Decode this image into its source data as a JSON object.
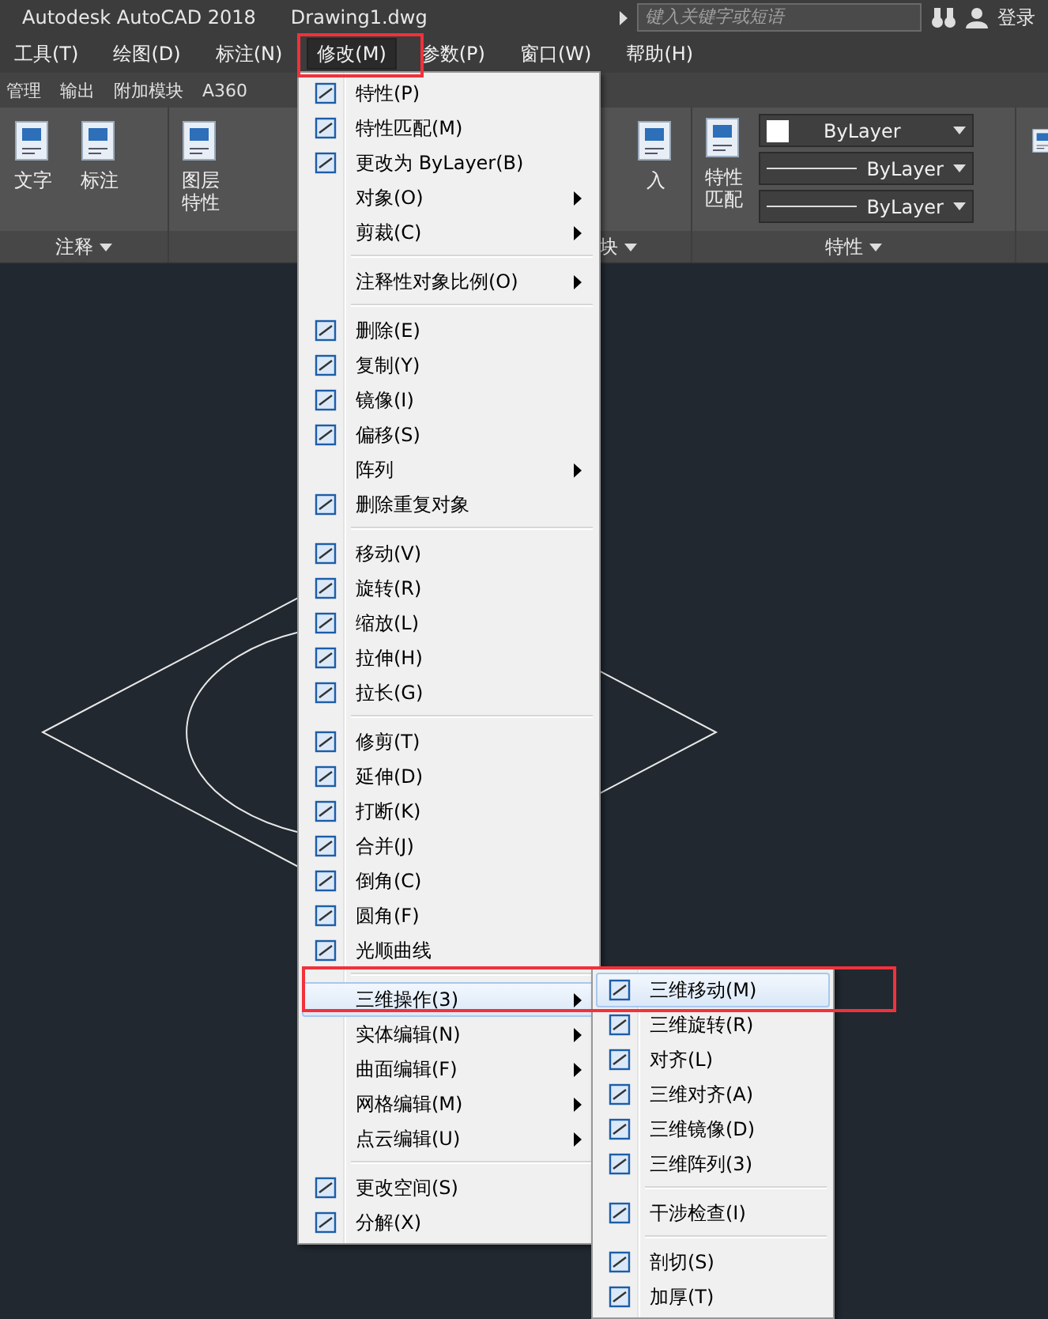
{
  "title_bar": {
    "app": "Autodesk AutoCAD 2018",
    "file": "Drawing1.dwg",
    "search": {
      "placeholder": "键入关键字或短语"
    },
    "sign_in": "登录"
  },
  "menu_bar": [
    {
      "label": "工具(T)",
      "selected": false
    },
    {
      "label": "绘图(D)",
      "selected": false
    },
    {
      "label": "标注(N)",
      "selected": false
    },
    {
      "label": "修改(M)",
      "selected": true
    },
    {
      "label": "参数(P)",
      "selected": false
    },
    {
      "label": "窗口(W)",
      "selected": false
    },
    {
      "label": "帮助(H)",
      "selected": false
    }
  ],
  "ribbon_tabs": [
    "管理",
    "输出",
    "附加模块",
    "A360"
  ],
  "ribbon": {
    "annotate": {
      "title": "注释",
      "buttons": [
        "文字",
        "标注"
      ]
    },
    "layers": {
      "buttons": [
        "图层特性",
        "入"
      ]
    },
    "block": {
      "title": "块"
    },
    "properties": {
      "title": "特性",
      "button": "特性匹配",
      "dropdowns": [
        {
          "kind": "color",
          "value": "ByLayer"
        },
        {
          "kind": "line",
          "value": "ByLayer"
        },
        {
          "kind": "line",
          "value": "ByLayer"
        }
      ]
    },
    "group": {
      "kind": "button"
    }
  },
  "modify_menu": [
    {
      "kind": "item",
      "label": "特性(P)",
      "icon": true,
      "submenu": false,
      "selected": false
    },
    {
      "kind": "item",
      "label": "特性匹配(M)",
      "icon": true,
      "submenu": false,
      "selected": false
    },
    {
      "kind": "item",
      "label": "更改为 ByLayer(B)",
      "icon": true,
      "submenu": false,
      "selected": false
    },
    {
      "kind": "item",
      "label": "对象(O)",
      "icon": false,
      "submenu": true,
      "selected": false
    },
    {
      "kind": "item",
      "label": "剪裁(C)",
      "icon": false,
      "submenu": true,
      "selected": false
    },
    {
      "kind": "separator"
    },
    {
      "kind": "item",
      "label": "注释性对象比例(O)",
      "icon": false,
      "submenu": true,
      "selected": false
    },
    {
      "kind": "separator"
    },
    {
      "kind": "item",
      "label": "删除(E)",
      "icon": true,
      "submenu": false,
      "selected": false
    },
    {
      "kind": "item",
      "label": "复制(Y)",
      "icon": true,
      "submenu": false,
      "selected": false
    },
    {
      "kind": "item",
      "label": "镜像(I)",
      "icon": true,
      "submenu": false,
      "selected": false
    },
    {
      "kind": "item",
      "label": "偏移(S)",
      "icon": true,
      "submenu": false,
      "selected": false
    },
    {
      "kind": "item",
      "label": "阵列",
      "icon": false,
      "submenu": true,
      "selected": false
    },
    {
      "kind": "item",
      "label": "删除重复对象",
      "icon": true,
      "submenu": false,
      "selected": false
    },
    {
      "kind": "separator"
    },
    {
      "kind": "item",
      "label": "移动(V)",
      "icon": true,
      "submenu": false,
      "selected": false
    },
    {
      "kind": "item",
      "label": "旋转(R)",
      "icon": true,
      "submenu": false,
      "selected": false
    },
    {
      "kind": "item",
      "label": "缩放(L)",
      "icon": true,
      "submenu": false,
      "selected": false
    },
    {
      "kind": "item",
      "label": "拉伸(H)",
      "icon": true,
      "submenu": false,
      "selected": false
    },
    {
      "kind": "item",
      "label": "拉长(G)",
      "icon": true,
      "submenu": false,
      "selected": false
    },
    {
      "kind": "separator"
    },
    {
      "kind": "item",
      "label": "修剪(T)",
      "icon": true,
      "submenu": false,
      "selected": false
    },
    {
      "kind": "item",
      "label": "延伸(D)",
      "icon": true,
      "submenu": false,
      "selected": false
    },
    {
      "kind": "item",
      "label": "打断(K)",
      "icon": true,
      "submenu": false,
      "selected": false
    },
    {
      "kind": "item",
      "label": "合并(J)",
      "icon": true,
      "submenu": false,
      "selected": false
    },
    {
      "kind": "item",
      "label": "倒角(C)",
      "icon": true,
      "submenu": false,
      "selected": false
    },
    {
      "kind": "item",
      "label": "圆角(F)",
      "icon": true,
      "submenu": false,
      "selected": false
    },
    {
      "kind": "item",
      "label": "光顺曲线",
      "icon": true,
      "submenu": false,
      "selected": false
    },
    {
      "kind": "separator"
    },
    {
      "kind": "item",
      "label": "三维操作(3)",
      "icon": false,
      "submenu": true,
      "selected": true
    },
    {
      "kind": "item",
      "label": "实体编辑(N)",
      "icon": false,
      "submenu": true,
      "selected": false
    },
    {
      "kind": "item",
      "label": "曲面编辑(F)",
      "icon": false,
      "submenu": true,
      "selected": false
    },
    {
      "kind": "item",
      "label": "网格编辑(M)",
      "icon": false,
      "submenu": true,
      "selected": false
    },
    {
      "kind": "item",
      "label": "点云编辑(U)",
      "icon": false,
      "submenu": true,
      "selected": false
    },
    {
      "kind": "separator"
    },
    {
      "kind": "item",
      "label": "更改空间(S)",
      "icon": true,
      "submenu": false,
      "selected": false
    },
    {
      "kind": "item",
      "label": "分解(X)",
      "icon": true,
      "submenu": false,
      "selected": false
    }
  ],
  "submenu_3d": [
    {
      "kind": "item",
      "label": "三维移动(M)",
      "icon": true,
      "submenu": false,
      "selected": true
    },
    {
      "kind": "item",
      "label": "三维旋转(R)",
      "icon": true,
      "submenu": false,
      "selected": false
    },
    {
      "kind": "item",
      "label": "对齐(L)",
      "icon": true,
      "submenu": false,
      "selected": false
    },
    {
      "kind": "item",
      "label": "三维对齐(A)",
      "icon": true,
      "submenu": false,
      "selected": false
    },
    {
      "kind": "item",
      "label": "三维镜像(D)",
      "icon": true,
      "submenu": false,
      "selected": false
    },
    {
      "kind": "item",
      "label": "三维阵列(3)",
      "icon": true,
      "submenu": false,
      "selected": false
    },
    {
      "kind": "separator"
    },
    {
      "kind": "item",
      "label": "干涉检查(I)",
      "icon": true,
      "submenu": false,
      "selected": false
    },
    {
      "kind": "separator"
    },
    {
      "kind": "item",
      "label": "剖切(S)",
      "icon": true,
      "submenu": false,
      "selected": false
    },
    {
      "kind": "item",
      "label": "加厚(T)",
      "icon": true,
      "submenu": false,
      "selected": false
    }
  ]
}
